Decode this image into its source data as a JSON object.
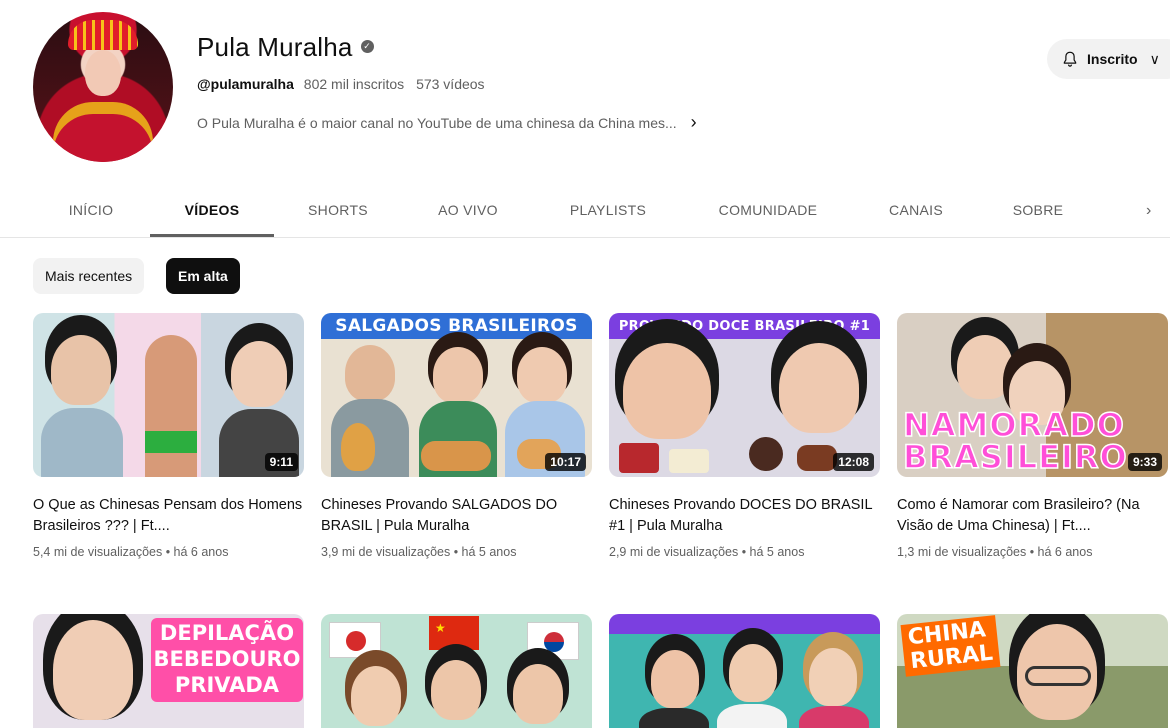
{
  "channel": {
    "name": "Pula Muralha",
    "verified_mark": "✓",
    "handle": "@pulamuralha",
    "subscribers": "802 mil inscritos",
    "videos_count": "573 vídeos",
    "description": "O Pula Muralha é o maior canal no YouTube de uma chinesa da China mes...",
    "desc_more": "›",
    "subscribe_label": "Inscrito",
    "subscribe_caret": "∨"
  },
  "tabs": [
    {
      "label": "INÍCIO"
    },
    {
      "label": "VÍDEOS"
    },
    {
      "label": "SHORTS"
    },
    {
      "label": "AO VIVO"
    },
    {
      "label": "PLAYLISTS"
    },
    {
      "label": "COMUNIDADE"
    },
    {
      "label": "CANAIS"
    },
    {
      "label": "SOBRE"
    }
  ],
  "tabs_more": "›",
  "active_tab": "VÍDEOS",
  "chips": [
    {
      "label": "Mais recentes",
      "selected": false
    },
    {
      "label": "Em alta",
      "selected": true
    }
  ],
  "videos": [
    {
      "title": "O Que as Chinesas Pensam dos Homens Brasileiros ??? | Ft....",
      "meta": "5,4 mi de visualizações • há 6 anos",
      "duration": "9:11"
    },
    {
      "title": "Chineses Provando SALGADOS DO BRASIL | Pula Muralha",
      "meta": "3,9 mi de visualizações • há 5 anos",
      "duration": "10:17",
      "banner": "SALGADOS BRASILEIROS"
    },
    {
      "title": "Chineses Provando DOCES DO BRASIL #1 | Pula Muralha",
      "meta": "2,9 mi de visualizações • há 5 anos",
      "duration": "12:08",
      "banner": "PROVANDO DOCE BRASILEIRO #1"
    },
    {
      "title": "Como é Namorar com Brasileiro? (Na Visão de Uma Chinesa) | Ft....",
      "meta": "1,3 mi de visualizações • há 6 anos",
      "duration": "9:33",
      "overlay_line1": "NAMORADO",
      "overlay_line2": "BRASILEIRO"
    }
  ],
  "row2": [
    {
      "overlay_line1": "DEPILAÇÃO",
      "overlay_line2": "BEBEDOURO",
      "overlay_line3": "PRIVADA"
    },
    {},
    {},
    {
      "overlay_line1": "CHINA",
      "overlay_line2": "RURAL"
    }
  ],
  "colors": {
    "accent_dark": "#0f0f0f",
    "muted_text": "#606060",
    "chip_bg": "#f2f2f2",
    "banner_blue": "#2f6fd6",
    "banner_purple": "#7b3fe0",
    "overlay_pink": "#ff4fd8"
  }
}
